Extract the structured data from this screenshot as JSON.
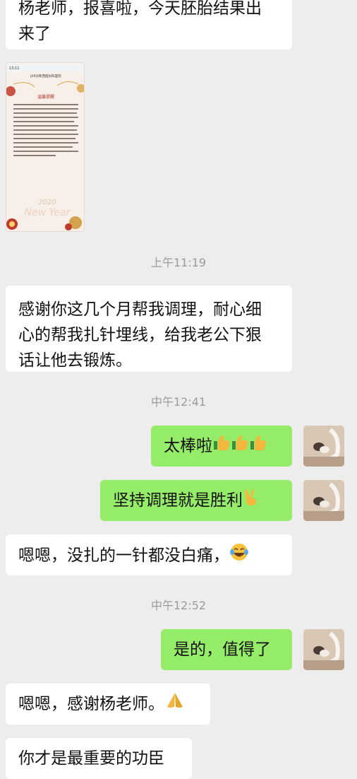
{
  "messages": [
    {
      "side": "left",
      "text_lines": [
        "杨老师，报喜啦，今天胚胎结果出",
        "来了"
      ]
    },
    {
      "side": "left",
      "type": "image",
      "image": {
        "status_time": "13:11",
        "header_title": "JXR诊断西医妇科医院",
        "card_title": "温馨提醒",
        "signature_text": "New Year",
        "year_text": "2020"
      }
    },
    {
      "type": "timestamp",
      "text": "上午11:19"
    },
    {
      "side": "left",
      "text_lines": [
        "感谢你这几个月帮我调理，耐心细",
        "心的帮我扎针埋线，给我老公下狠",
        "话让他去锻炼。"
      ]
    },
    {
      "type": "timestamp",
      "text": "中午12:41"
    },
    {
      "side": "right",
      "text": "太棒啦",
      "emoji": "thumbs-up",
      "emoji_count": 3
    },
    {
      "side": "right",
      "text": "坚持调理就是胜利",
      "emoji": "victory-hand"
    },
    {
      "side": "left",
      "text": "嗯嗯，没扎的一针都没白痛，",
      "emoji": "tears-of-joy"
    },
    {
      "type": "timestamp",
      "text": "中午12:52"
    },
    {
      "side": "right",
      "text": "是的，值得了"
    },
    {
      "side": "left",
      "text": "嗯嗯，感谢杨老师。",
      "emoji": "folded-hands"
    },
    {
      "side": "left",
      "text": "你才是最重要的功臣"
    }
  ],
  "colors": {
    "background": "#ededed",
    "incoming_bubble": "#ffffff",
    "outgoing_bubble": "#95ec69",
    "timestamp_text": "#9b9b9b"
  }
}
